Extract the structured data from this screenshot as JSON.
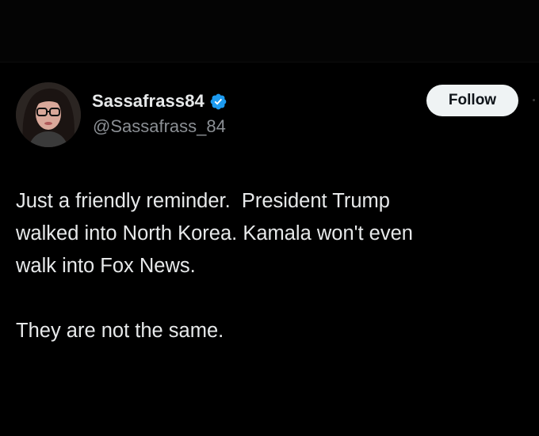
{
  "post": {
    "author": {
      "display_name": "Sassafrass84",
      "handle": "@Sassafrass_84",
      "verified": true,
      "avatar_icon": "profile-photo"
    },
    "follow_label": "Follow",
    "text_lines": [
      "Just a friendly reminder.  President Trump",
      "walked into North Korea. Kamala won't even",
      "walk into Fox News.",
      "They are not the same."
    ]
  },
  "colors": {
    "background": "#000000",
    "text_primary": "#e7e9ea",
    "text_secondary": "#8b8f94",
    "verified_badge": "#1d9bf0",
    "follow_button_bg": "#eff3f4"
  }
}
